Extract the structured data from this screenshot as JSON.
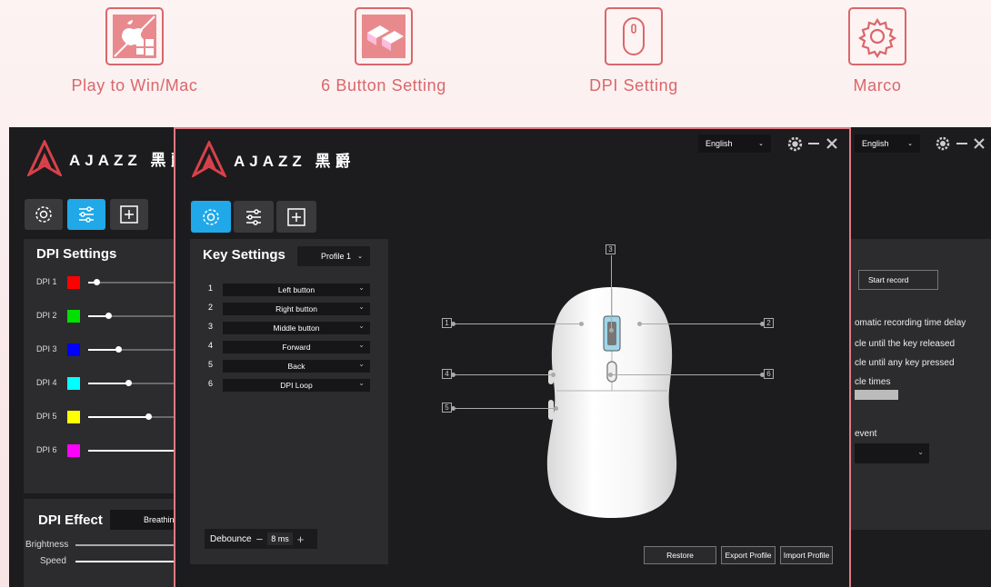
{
  "features": [
    {
      "label": "Play to Win/Mac",
      "icon": "apple-windows-icon"
    },
    {
      "label": "6 Button Setting",
      "icon": "keycaps-icon"
    },
    {
      "label": "DPI Setting",
      "icon": "mouse-icon"
    },
    {
      "label": "Marco",
      "icon": "gear-icon"
    }
  ],
  "brand": {
    "name": "AJAZZ",
    "cn": "黑爵",
    "accent": "#d9676b",
    "active_tab": "#20a8e8"
  },
  "background_window": {
    "language": "English",
    "dpi_settings": {
      "title": "DPI Settings",
      "rows": [
        {
          "label": "DPI 1",
          "color": "#ff0000",
          "level": 0.08
        },
        {
          "label": "DPI 2",
          "color": "#00e000",
          "level": 0.2
        },
        {
          "label": "DPI 3",
          "color": "#0000ff",
          "level": 0.3
        },
        {
          "label": "DPI 4",
          "color": "#00ffff",
          "level": 0.4
        },
        {
          "label": "DPI 5",
          "color": "#ffff00",
          "level": 0.6
        },
        {
          "label": "DPI 6",
          "color": "#ff00ff",
          "level": 1.0
        }
      ]
    },
    "dpi_effect": {
      "title": "DPI Effect",
      "mode": "Breathing",
      "brightness_label": "Brightness",
      "speed_label": "Speed"
    },
    "macro": {
      "start_record": "Start record",
      "opt1": "omatic recording time delay",
      "opt2": "cle until the key released",
      "opt3": "cle until any key pressed",
      "opt4": "cle times",
      "event": "event"
    }
  },
  "main_window": {
    "language": "English",
    "key_settings": {
      "title": "Key Settings",
      "profile": "Profile 1",
      "keys": [
        {
          "num": "1",
          "action": "Left button"
        },
        {
          "num": "2",
          "action": "Right button"
        },
        {
          "num": "3",
          "action": "Middle button"
        },
        {
          "num": "4",
          "action": "Forward"
        },
        {
          "num": "5",
          "action": "Back"
        },
        {
          "num": "6",
          "action": "DPI Loop"
        }
      ],
      "debounce_label": "Debounce",
      "debounce_value": "8 ms",
      "minus": "−",
      "plus": "+"
    },
    "callouts": [
      "1",
      "2",
      "3",
      "4",
      "5",
      "6"
    ],
    "buttons": {
      "restore": "Restore",
      "export": "Export Profile",
      "import": "Import Profile"
    }
  }
}
